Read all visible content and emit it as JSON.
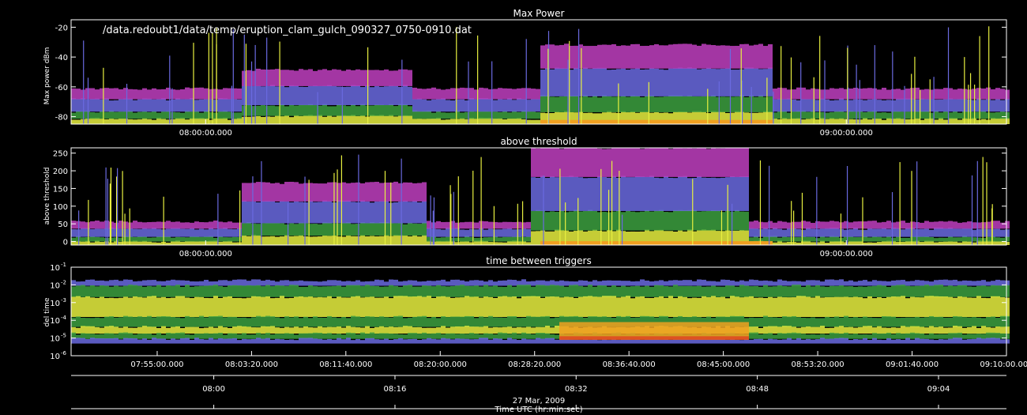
{
  "file_path": "/data.redoubt1/data/temp/eruption_clam_gulch_090327_0750-0910.dat",
  "date_label": "27 Mar, 2009",
  "time_axis_title": "Time UTC (hr:min:sec)",
  "chart_data": [
    {
      "type": "heatmap",
      "title": "Max Power",
      "ylabel": "Max power dBm",
      "ylim": [
        -85,
        -15
      ],
      "y_ticks": [
        "-20",
        "-40",
        "-60",
        "-80"
      ],
      "x_tick_labels": [
        "08:00:00.000",
        "09:00:00.000"
      ],
      "x_tick_values": [
        8.0,
        9.0
      ],
      "xlim": [
        7.79,
        9.25
      ]
    },
    {
      "type": "heatmap",
      "title": "above threshold",
      "ylabel": "above threshold",
      "ylim": [
        -10,
        265
      ],
      "y_ticks": [
        "250",
        "200",
        "150",
        "100",
        "50",
        "0"
      ],
      "x_tick_labels": [
        "08:00:00.000",
        "09:00:00.000"
      ],
      "x_tick_values": [
        8.0,
        9.0
      ],
      "xlim": [
        7.79,
        9.25
      ]
    },
    {
      "type": "heatmap",
      "title": "time between triggers",
      "ylabel": "del time",
      "scale": "log",
      "ylim": [
        1e-06,
        0.1
      ],
      "y_ticks": [
        "10-1",
        "10-2",
        "10-3",
        "10-4",
        "10-5",
        "10-6"
      ],
      "x_tick_labels": [
        "07:55:00.000",
        "08:03:20.000",
        "08:11:40.000",
        "08:20:00.000",
        "08:28:20.000",
        "08:36:40.000",
        "08:45:00.000",
        "08:53:20.000",
        "09:01:40.000",
        "09:10:00.000"
      ],
      "x_tick_values": [
        7.9167,
        8.0556,
        8.1944,
        8.3333,
        8.4722,
        8.6111,
        8.75,
        8.8889,
        9.0278,
        9.1667
      ],
      "xlim": [
        7.79,
        9.1667
      ],
      "secondary_axis_labels": [
        "08:00",
        "08:16",
        "08:32",
        "08:48",
        "09:04"
      ],
      "secondary_axis_values": [
        8.0,
        8.2667,
        8.5333,
        8.8,
        9.0667
      ]
    }
  ],
  "colors": {
    "background": "#000000",
    "magenta": "#c040c0",
    "blue": "#6a6ae0",
    "green": "#3ca040",
    "yellow": "#e8f040",
    "orange": "#f0a020",
    "red": "#e04020"
  }
}
